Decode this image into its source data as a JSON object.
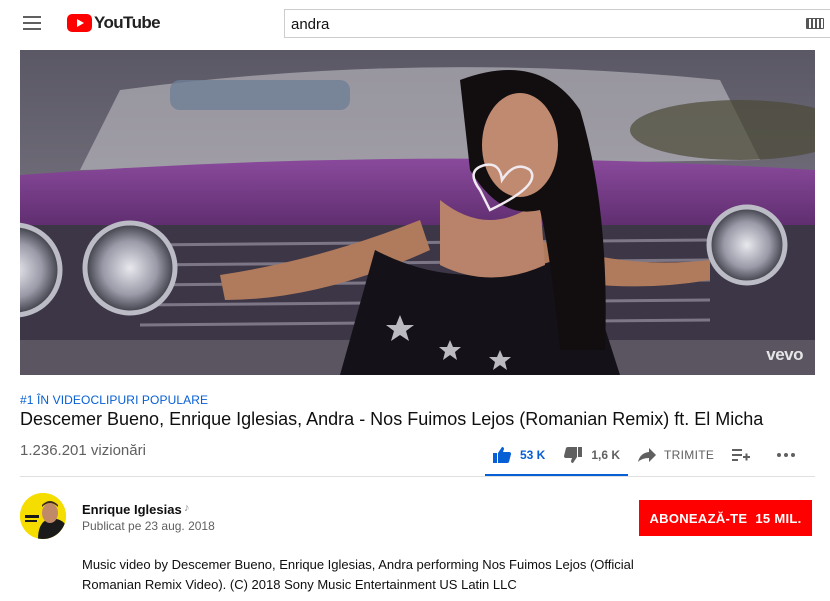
{
  "header": {
    "logo_text": "YouTube",
    "search_value": "andra"
  },
  "player": {
    "watermark": "vevo"
  },
  "video": {
    "tag": "#1 ÎN VIDEOCLIPURI POPULARE",
    "title": "Descemer Bueno, Enrique Iglesias, Andra - Nos Fuimos Lejos (Romanian Remix) ft. El Micha",
    "views": "1.236.201 vizionări",
    "likes": "53 K",
    "dislikes": "1,6 K",
    "share_label": "TRIMITE"
  },
  "channel": {
    "name": "Enrique Iglesias",
    "published": "Publicat pe 23 aug. 2018",
    "subscribe_label": "ABONEAZĂ-TE",
    "subscriber_count": "15 MIL."
  },
  "description": {
    "line1": "Music video by Descemer Bueno, Enrique Iglesias, Andra performing Nos Fuimos Lejos (Official",
    "line2": "Romanian Remix Video). (C) 2018 Sony Music Entertainment US Latin LLC"
  },
  "colors": {
    "accent": "#065fd4",
    "brand": "#ff0000"
  }
}
